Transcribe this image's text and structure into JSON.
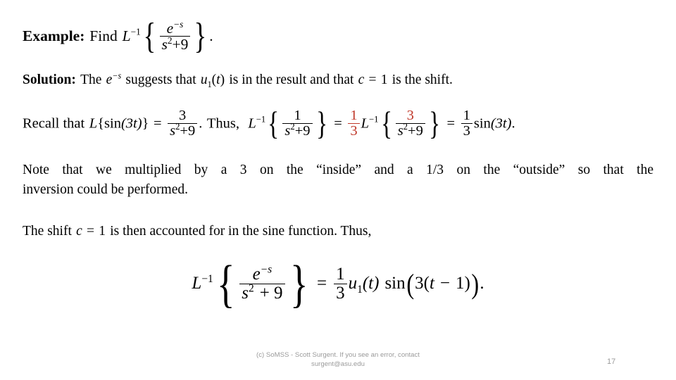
{
  "slide": {
    "page_number": "17",
    "background_color": "#FFFFFF",
    "text_color": "#000000",
    "accent_color": "#C0392B",
    "footer_color": "#9A9A9A"
  },
  "example": {
    "label": "Example:",
    "verb": "Find",
    "operator": "L",
    "operator_exponent": "−1",
    "numerator": "e",
    "numerator_exponent": "−s",
    "denominator_base": "s",
    "denominator_exponent": "2",
    "denominator_tail": "+9",
    "period": "."
  },
  "solution": {
    "label": "Solution:",
    "text_1": "The",
    "term_e": "e",
    "term_e_exponent": "−s",
    "text_2": "suggests that",
    "term_u": "u",
    "term_u_sub": "1",
    "term_u_arg_open": "(",
    "term_u_arg": "t",
    "term_u_arg_close": ")",
    "text_3": "is in the result and that",
    "term_c": "c",
    "equals": "=",
    "shift_value": "1",
    "text_4": "is the shift."
  },
  "recall": {
    "text_1": "Recall that",
    "lap_L": "L",
    "brace_open": "{",
    "sin_fn": "sin",
    "sin_arg": "(3t)",
    "brace_close": "}",
    "equals_1": "=",
    "frac1_num": "3",
    "frac1_den_base": "s",
    "frac1_den_exp": "2",
    "frac1_den_tail": "+9",
    "period_1": ".",
    "text_2": "Thus,",
    "inv_L_2": "L",
    "inv_exp_2": "−1",
    "frac2_num": "1",
    "frac2_den_base": "s",
    "frac2_den_exp": "2",
    "frac2_den_tail": "+9",
    "equals_2": "=",
    "coef_num": "1",
    "coef_den": "3",
    "inv_L_3": "L",
    "inv_exp_3": "−1",
    "frac3_num": "3",
    "frac3_den_base": "s",
    "frac3_den_exp": "2",
    "frac3_den_tail": "+9",
    "equals_3": "=",
    "result_num": "1",
    "result_den": "3",
    "result_fn": "sin",
    "result_arg": "(3t)",
    "period_2": "."
  },
  "note": {
    "line_1": "Note that we multiplied by a 3 on the “inside” and a 1/3 on the “outside” so that the",
    "line_2": "inversion could be performed."
  },
  "shift": {
    "text_1": "The shift",
    "var_c": "c",
    "equals": "=",
    "value": "1",
    "text_2": "is then accounted for in the sine function. Thus,"
  },
  "display_equation": {
    "op_L": "L",
    "op_exp": "−1",
    "brace_open": "{",
    "num_e": "e",
    "num_exp": "−s",
    "den_s": "s",
    "den_exp": "2",
    "den_tail": "+ 9",
    "brace_close": "}",
    "equals": "=",
    "coef_num": "1",
    "coef_den": "3",
    "u_fn": "u",
    "u_sub": "1",
    "u_arg": "(t)",
    "sin_fn": "sin",
    "paren_open": "(",
    "sin_inner_3": "3",
    "inner_paren_open": "(",
    "inner_t": "t",
    "inner_minus": "−",
    "inner_1": "1",
    "inner_paren_close": ")",
    "paren_close": ")",
    "period": "."
  },
  "footer": {
    "credit_line_1": "(c) SoMSS - Scott Surgent. If you see an error, contact",
    "credit_line_2": "surgent@asu.edu",
    "page_number": "17"
  }
}
